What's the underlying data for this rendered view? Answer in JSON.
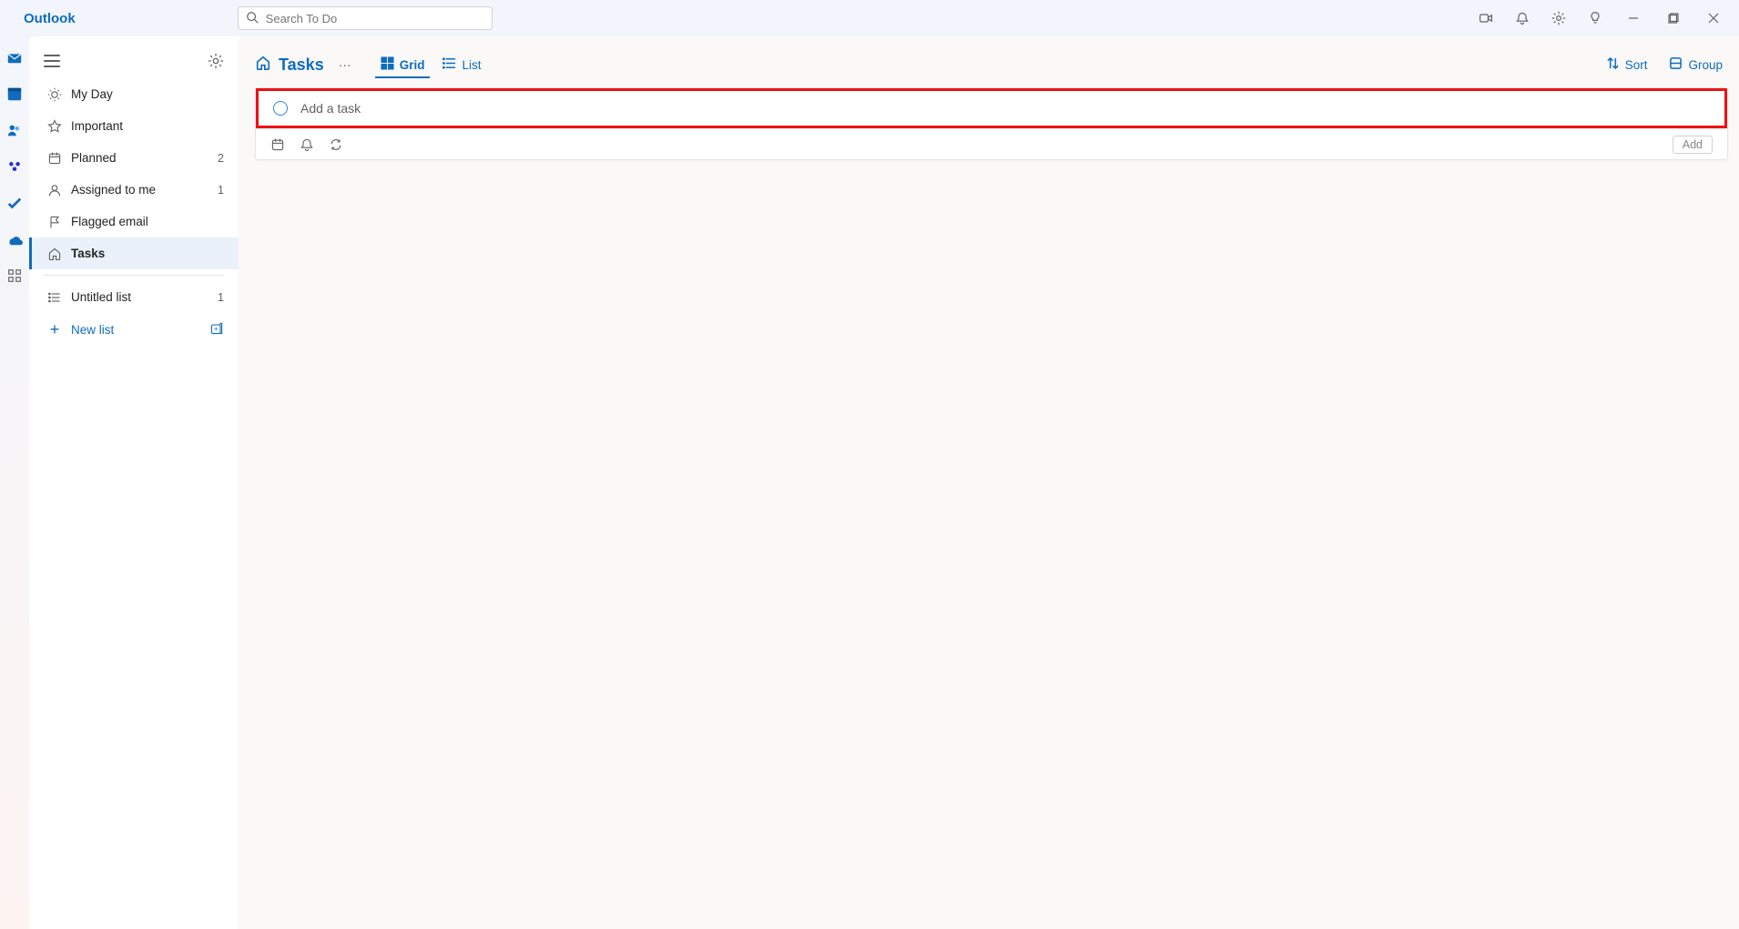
{
  "app": {
    "name": "Outlook"
  },
  "search": {
    "placeholder": "Search To Do"
  },
  "rail": {
    "items": [
      "mail",
      "calendar",
      "people",
      "groups",
      "todo",
      "onedrive",
      "more-apps"
    ]
  },
  "sidebar": {
    "items": [
      {
        "key": "myday",
        "label": "My Day",
        "count": ""
      },
      {
        "key": "important",
        "label": "Important",
        "count": ""
      },
      {
        "key": "planned",
        "label": "Planned",
        "count": "2"
      },
      {
        "key": "assigned",
        "label": "Assigned to me",
        "count": "1"
      },
      {
        "key": "flagged",
        "label": "Flagged email",
        "count": ""
      },
      {
        "key": "tasks",
        "label": "Tasks",
        "count": ""
      }
    ],
    "lists": [
      {
        "label": "Untitled list",
        "count": "1"
      }
    ],
    "new_list_label": "New list"
  },
  "header": {
    "title": "Tasks",
    "views": {
      "grid": "Grid",
      "list": "List"
    },
    "sort_label": "Sort",
    "group_label": "Group"
  },
  "task_input": {
    "placeholder": "Add a task",
    "add_button": "Add"
  }
}
